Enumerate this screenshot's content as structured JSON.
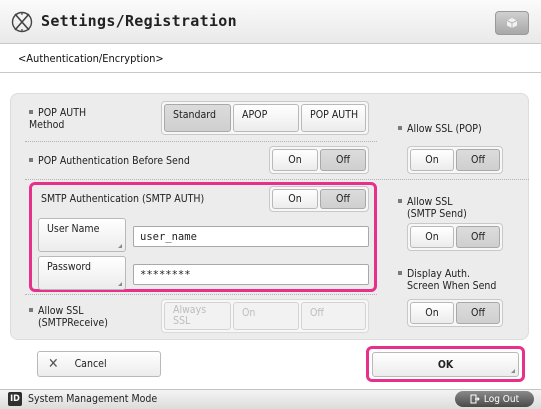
{
  "header": {
    "title": "Settings/Registration"
  },
  "subtitle": "<Authentication/Encryption>",
  "pop_auth_method": {
    "label": "POP AUTH\nMethod",
    "options": [
      "Standard",
      "APOP",
      "POP AUTH"
    ]
  },
  "allow_ssl_pop": {
    "label": "Allow SSL (POP)",
    "on": "On",
    "off": "Off"
  },
  "pop_before_send": {
    "label": "POP Authentication Before Send",
    "on": "On",
    "off": "Off"
  },
  "smtp_auth": {
    "label": "SMTP Authentication (SMTP AUTH)",
    "on": "On",
    "off": "Off",
    "user_name_label": "User Name",
    "user_name_value": "user_name",
    "password_label": "Password",
    "password_value": "********"
  },
  "allow_ssl_smtp_send": {
    "label": "Allow SSL\n(SMTP Send)",
    "on": "On",
    "off": "Off"
  },
  "display_auth_screen": {
    "label": "Display Auth.\nScreen When Send",
    "on": "On",
    "off": "Off"
  },
  "allow_ssl_smtp_receive": {
    "label": "Allow SSL\n(SMTPReceive)",
    "options": [
      "Always\nSSL",
      "On",
      "Off"
    ]
  },
  "actions": {
    "cancel": "Cancel",
    "ok": "OK"
  },
  "footer": {
    "mode_icon": "ID",
    "mode": "System Management Mode",
    "logout": "Log Out"
  },
  "colors": {
    "highlight": "#e8308a"
  }
}
